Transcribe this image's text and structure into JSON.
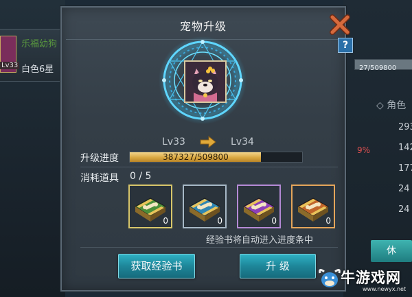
{
  "background": {
    "left_panel": {
      "pet_name": "乐福幼狗",
      "level": "Lv33",
      "quality": "白色6星"
    },
    "right_panel": {
      "exp_text": "27/509800",
      "role_label": "角色",
      "stats": [
        "293",
        "142",
        "177",
        "24",
        "24"
      ],
      "percent": "9%",
      "rest_button": "休"
    }
  },
  "dialog": {
    "title": "宠物升级",
    "level_from": "Lv33",
    "level_to": "Lv34",
    "progress_label": "升级进度",
    "progress_text": "387327/509800",
    "progress_fraction": 0.76,
    "consume_label": "消耗道具",
    "consume_count": "0 / 5",
    "items": [
      {
        "name": "green-exp-book",
        "count": "0",
        "color": "#4a8f3a",
        "frame": "#d8c66a"
      },
      {
        "name": "blue-exp-book",
        "count": "0",
        "color": "#2f86b3",
        "frame": "#a7b8c6"
      },
      {
        "name": "purple-exp-book",
        "count": "0",
        "color": "#8d3fb8",
        "frame": "#b58ad6"
      },
      {
        "name": "orange-exp-book",
        "count": "0",
        "color": "#c0652a",
        "frame": "#e5a55a"
      }
    ],
    "hint": "经验书将自动进入进度条中",
    "get_book_button": "获取经验书",
    "upgrade_button": "升 级"
  },
  "watermark": {
    "text": "牛游戏网",
    "url": "www.newyx.net"
  },
  "colors": {
    "accent": "#2fb1c4",
    "progress": "#d9a842",
    "portal": "#3fc6f2",
    "close": "#c0502a"
  }
}
